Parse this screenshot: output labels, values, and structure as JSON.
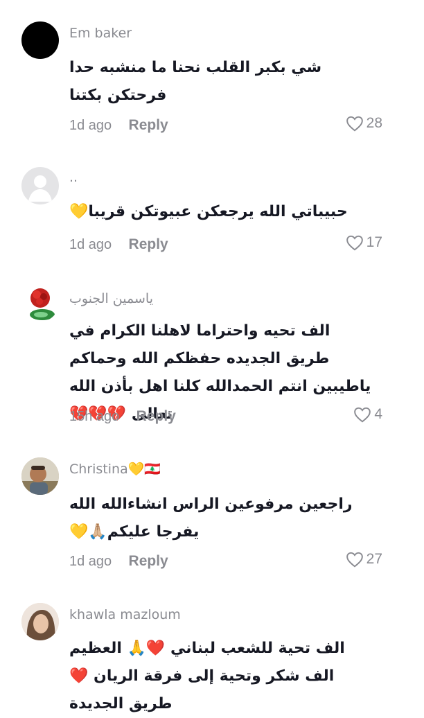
{
  "comments": [
    {
      "username": "Em baker",
      "text": "شي بكبر القلب نحنا ما منشبه حدا فرحتكن بكتنا",
      "time": "1d ago",
      "reply": "Reply",
      "likes": "28"
    },
    {
      "username": "..",
      "text": "حبيباتي الله يرجعكن عبيوتكن قريبا💛",
      "time": "1d ago",
      "reply": "Reply",
      "likes": "17"
    },
    {
      "username": "ياسمين الجنوب",
      "text": "الف تحيه واحتراما لاهلنا الكرام في طريق الجديده حفظكم الله وحماكم ياطيبين انتم الحمدالله كلنا اهل بأذن الله تعالى 💔💔💔",
      "time": "15h ago",
      "reply": "Reply",
      "likes": "4"
    },
    {
      "username": "Christina💛🇱🇧",
      "text": "راجعين مرفوعين الراس انشاءالله الله يفرجا عليكم🙏🏼💛",
      "time": "1d ago",
      "reply": "Reply",
      "likes": "27"
    },
    {
      "username": "khawla mazloum",
      "text": "الف تحية للشعب لبناني ❤️🙏 العظيم الف شكر وتحية إلى فرقة الريان ❤️طريق الجديدة",
      "time": "",
      "reply": "",
      "likes": ""
    }
  ]
}
